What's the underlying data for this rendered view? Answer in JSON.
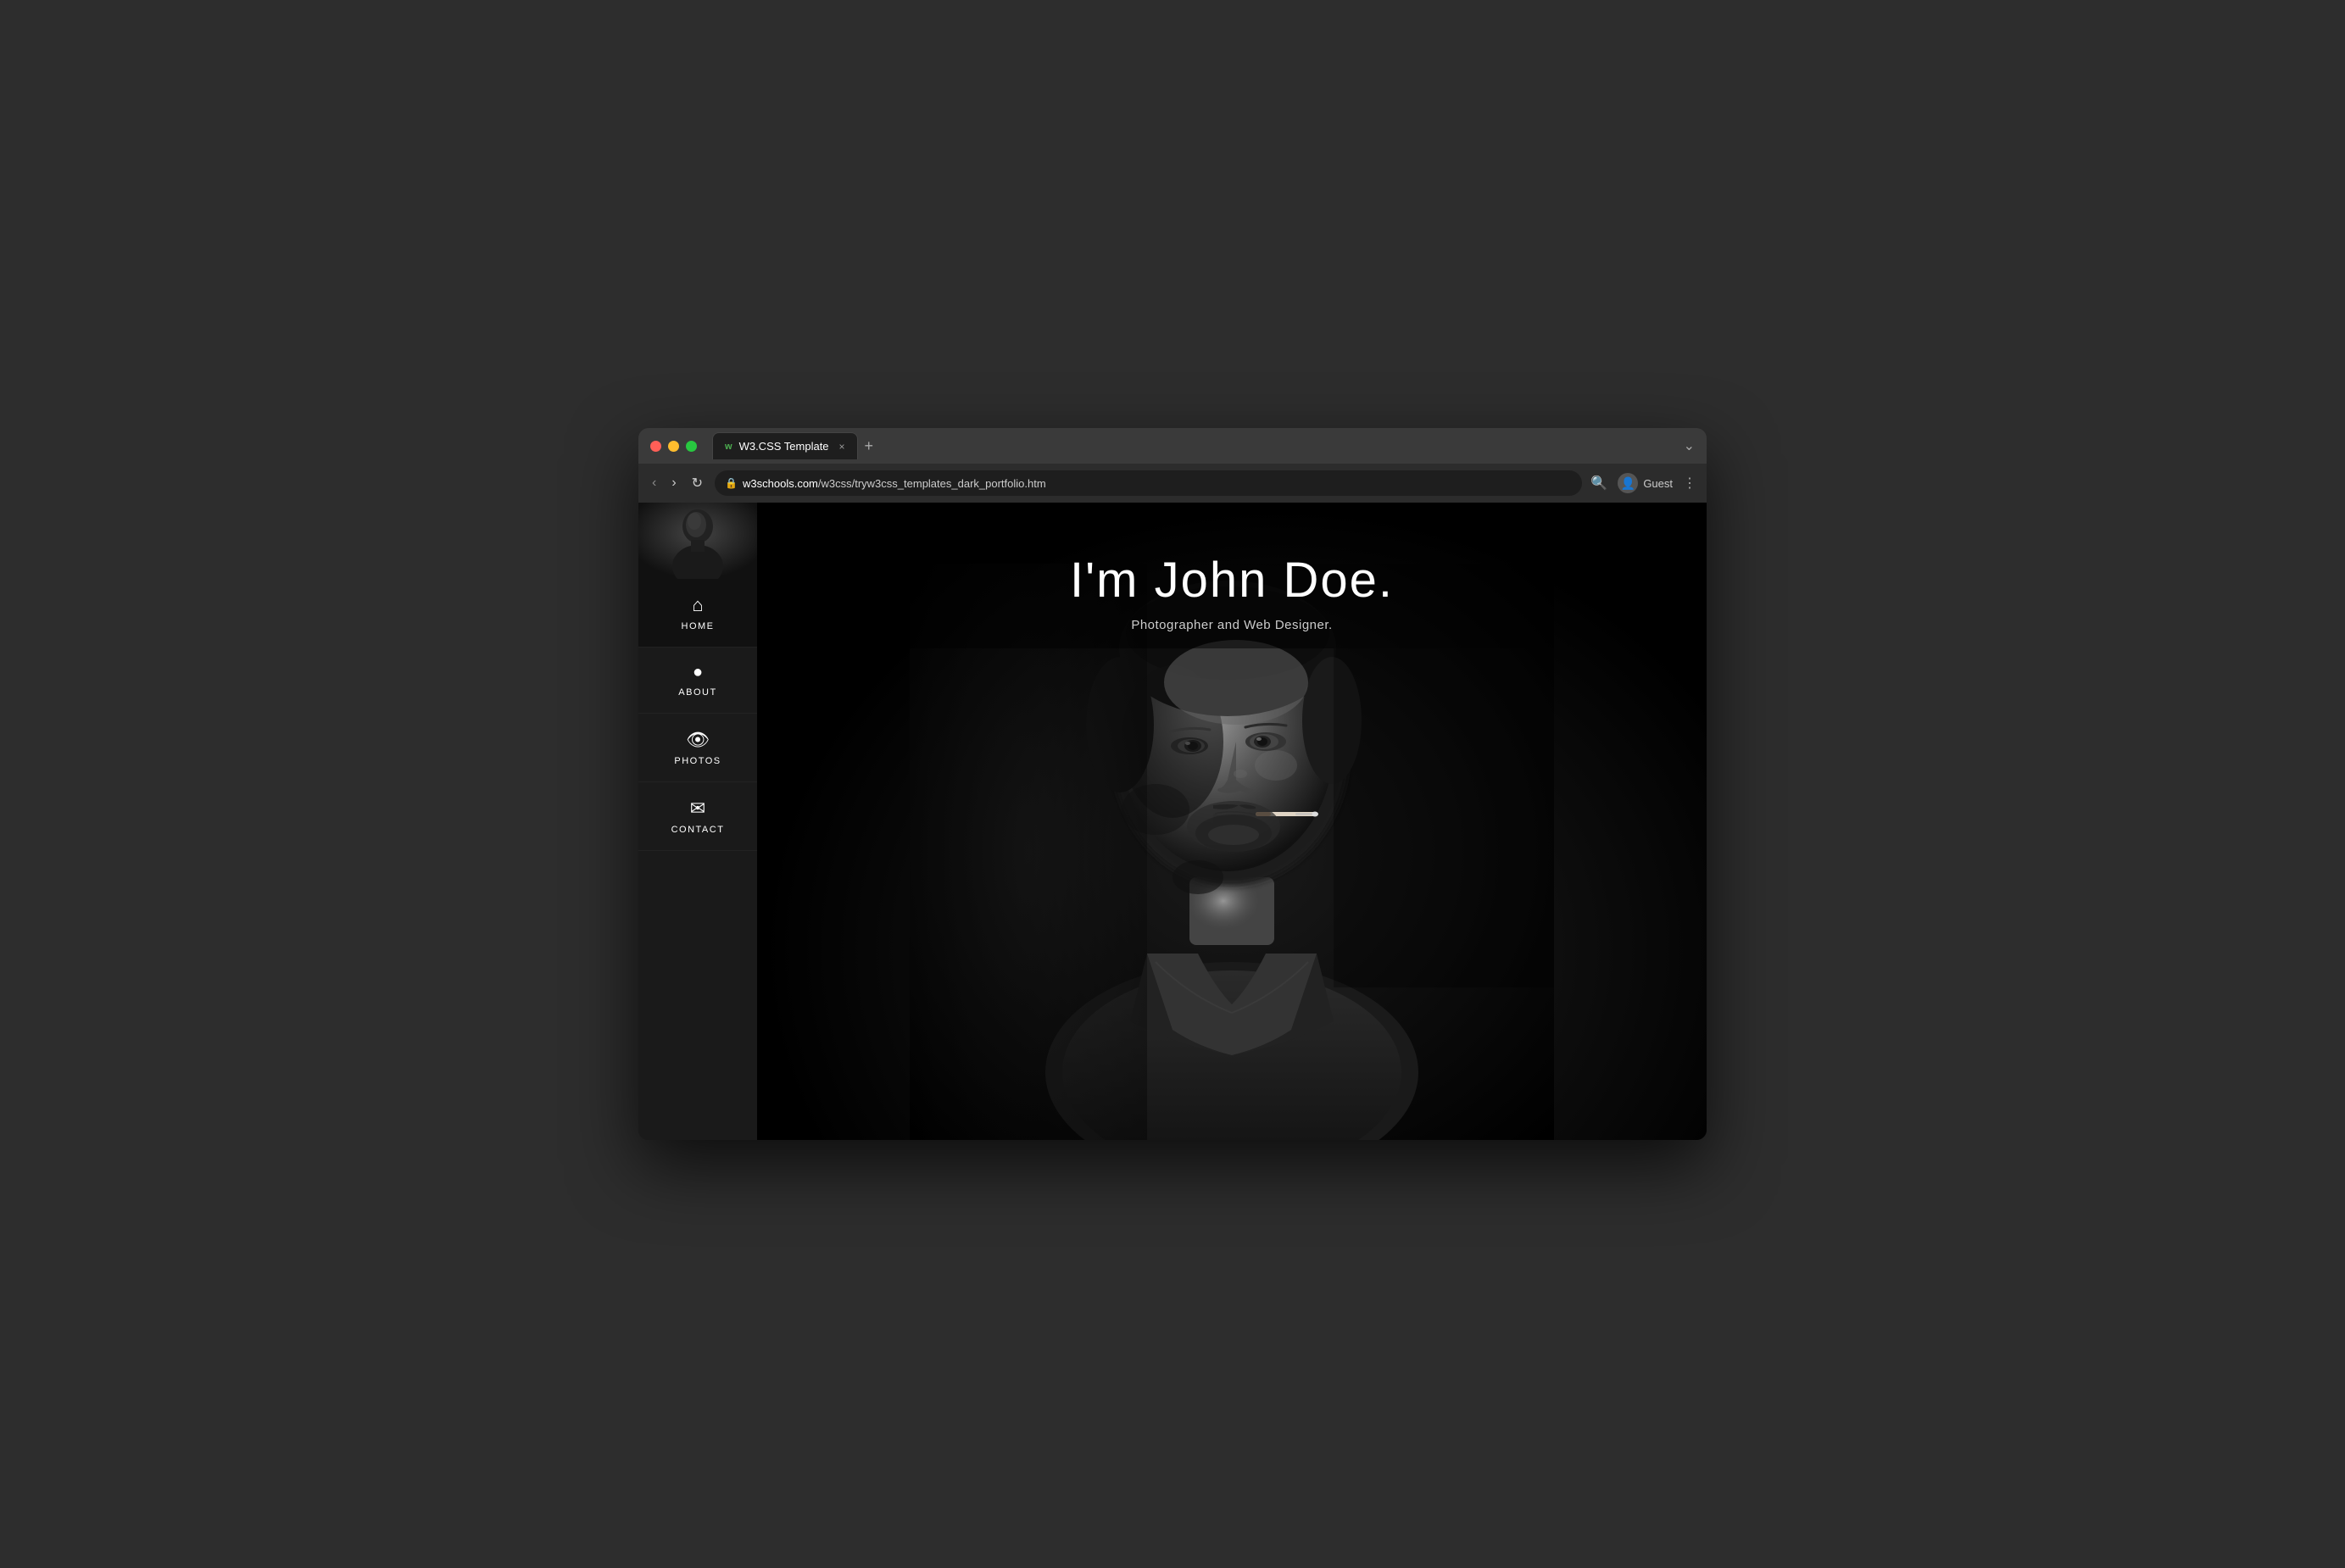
{
  "browser": {
    "tab_favicon": "w",
    "tab_title": "W3.CSS Template",
    "tab_close": "×",
    "new_tab": "+",
    "expand": "⌄",
    "nav_back": "‹",
    "nav_forward": "›",
    "nav_refresh": "↻",
    "address_lock": "🔒",
    "address_url_prefix": "w3schools.com",
    "address_url_path": "/w3css/tryw3css_templates_dark_portfolio.htm",
    "search_icon": "🔍",
    "user_icon": "👤",
    "username": "Guest",
    "more_icon": "⋮"
  },
  "sidebar": {
    "nav_items": [
      {
        "id": "home",
        "label": "HOME",
        "icon": "⌂",
        "active": true
      },
      {
        "id": "about",
        "label": "ABOUT",
        "icon": "👤",
        "active": false
      },
      {
        "id": "photos",
        "label": "PHOTOS",
        "icon": "👁",
        "active": false
      },
      {
        "id": "contact",
        "label": "CONTACT",
        "icon": "✉",
        "active": false
      }
    ]
  },
  "hero": {
    "title": "I'm John Doe.",
    "subtitle": "Photographer and Web Designer."
  }
}
